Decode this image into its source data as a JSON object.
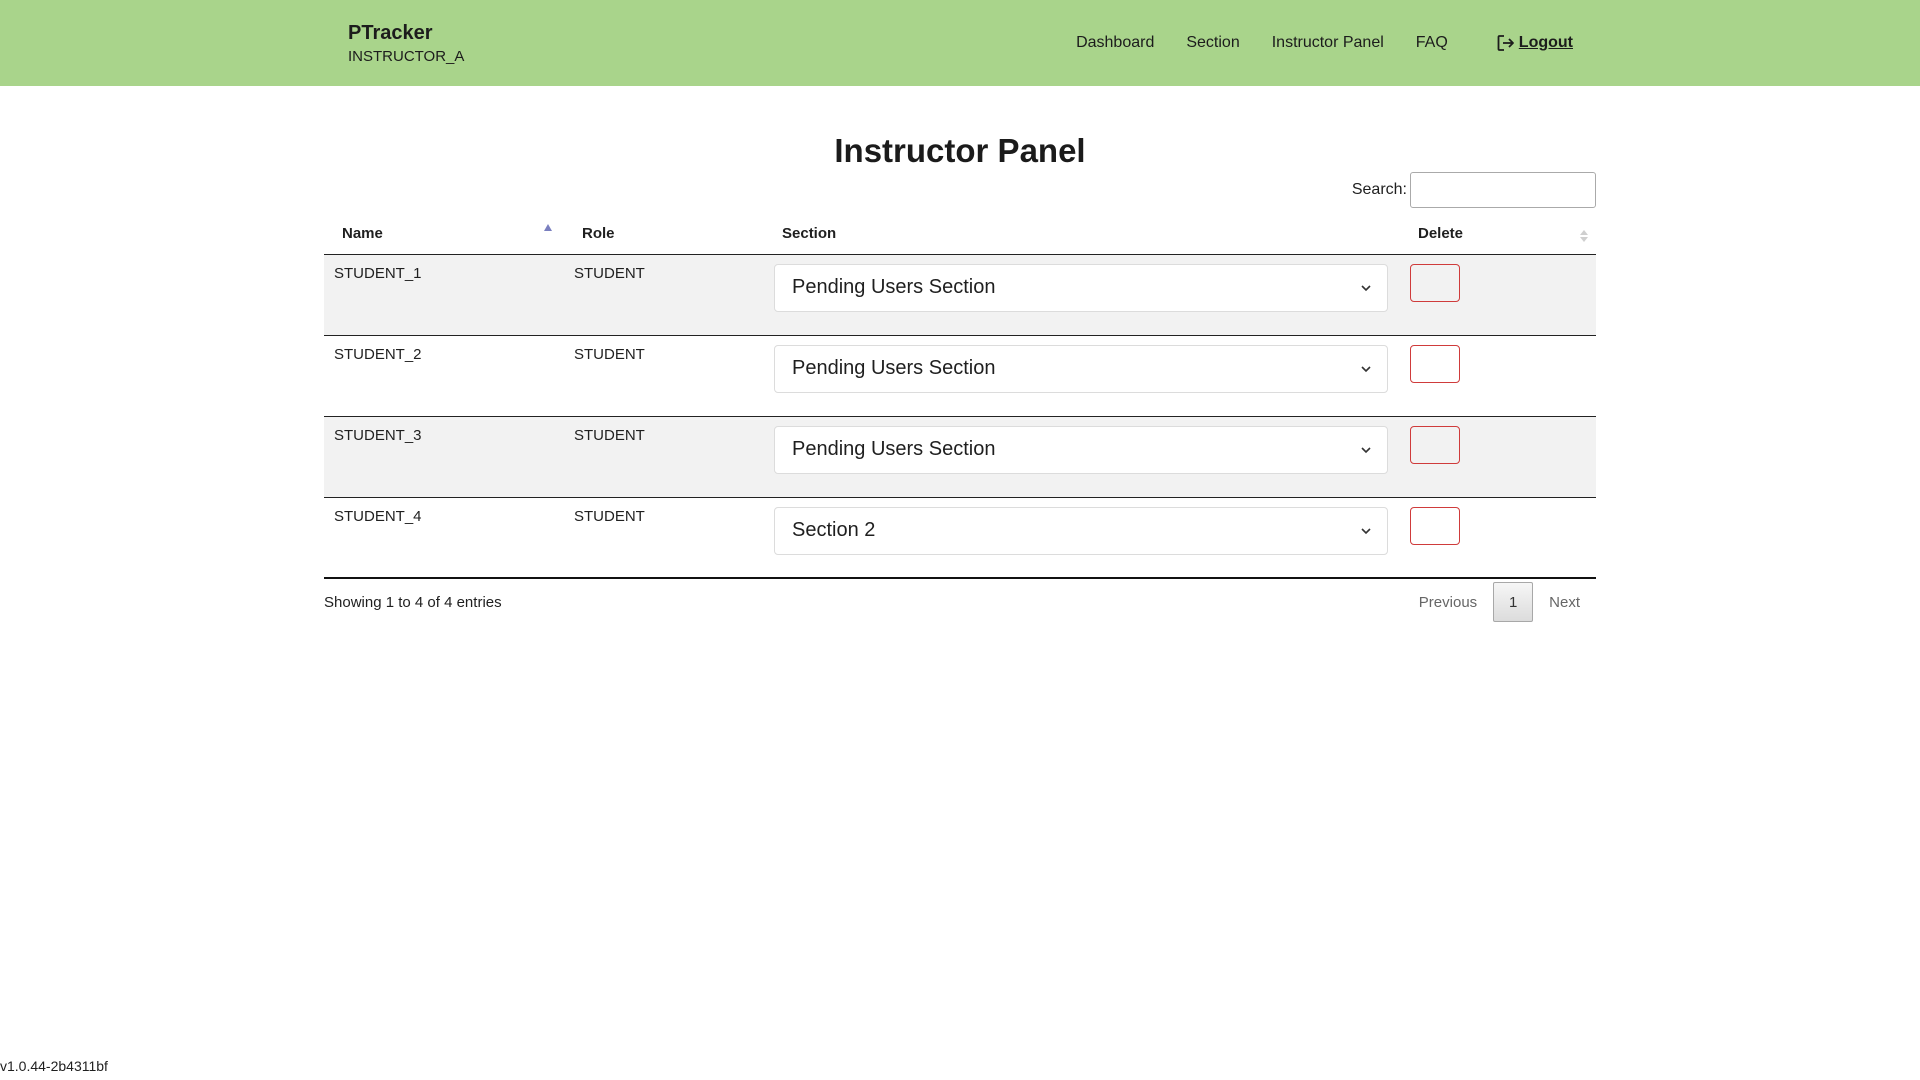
{
  "header": {
    "brand": "PTracker",
    "user": "INSTRUCTOR_A",
    "nav": [
      "Dashboard",
      "Section",
      "Instructor Panel",
      "FAQ"
    ],
    "logout": "Logout"
  },
  "main": {
    "title": "Instructor Panel",
    "search_label": "Search:",
    "search_value": "",
    "columns": [
      "Name",
      "Role",
      "Section",
      "Delete"
    ],
    "rows": [
      {
        "name": "STUDENT_1",
        "role": "STUDENT",
        "section": "Pending Users Section"
      },
      {
        "name": "STUDENT_2",
        "role": "STUDENT",
        "section": "Pending Users Section"
      },
      {
        "name": "STUDENT_3",
        "role": "STUDENT",
        "section": "Pending Users Section"
      },
      {
        "name": "STUDENT_4",
        "role": "STUDENT",
        "section": "Section 2"
      }
    ],
    "info": "Showing 1 to 4 of 4 entries",
    "pager": {
      "previous": "Previous",
      "current": "1",
      "next": "Next"
    }
  },
  "version": "v1.0.44-2b4311bf",
  "colors": {
    "header_bg": "#a9d48b",
    "delete_border": "#cf3b3b",
    "row_alt": "#f2f2f2"
  }
}
